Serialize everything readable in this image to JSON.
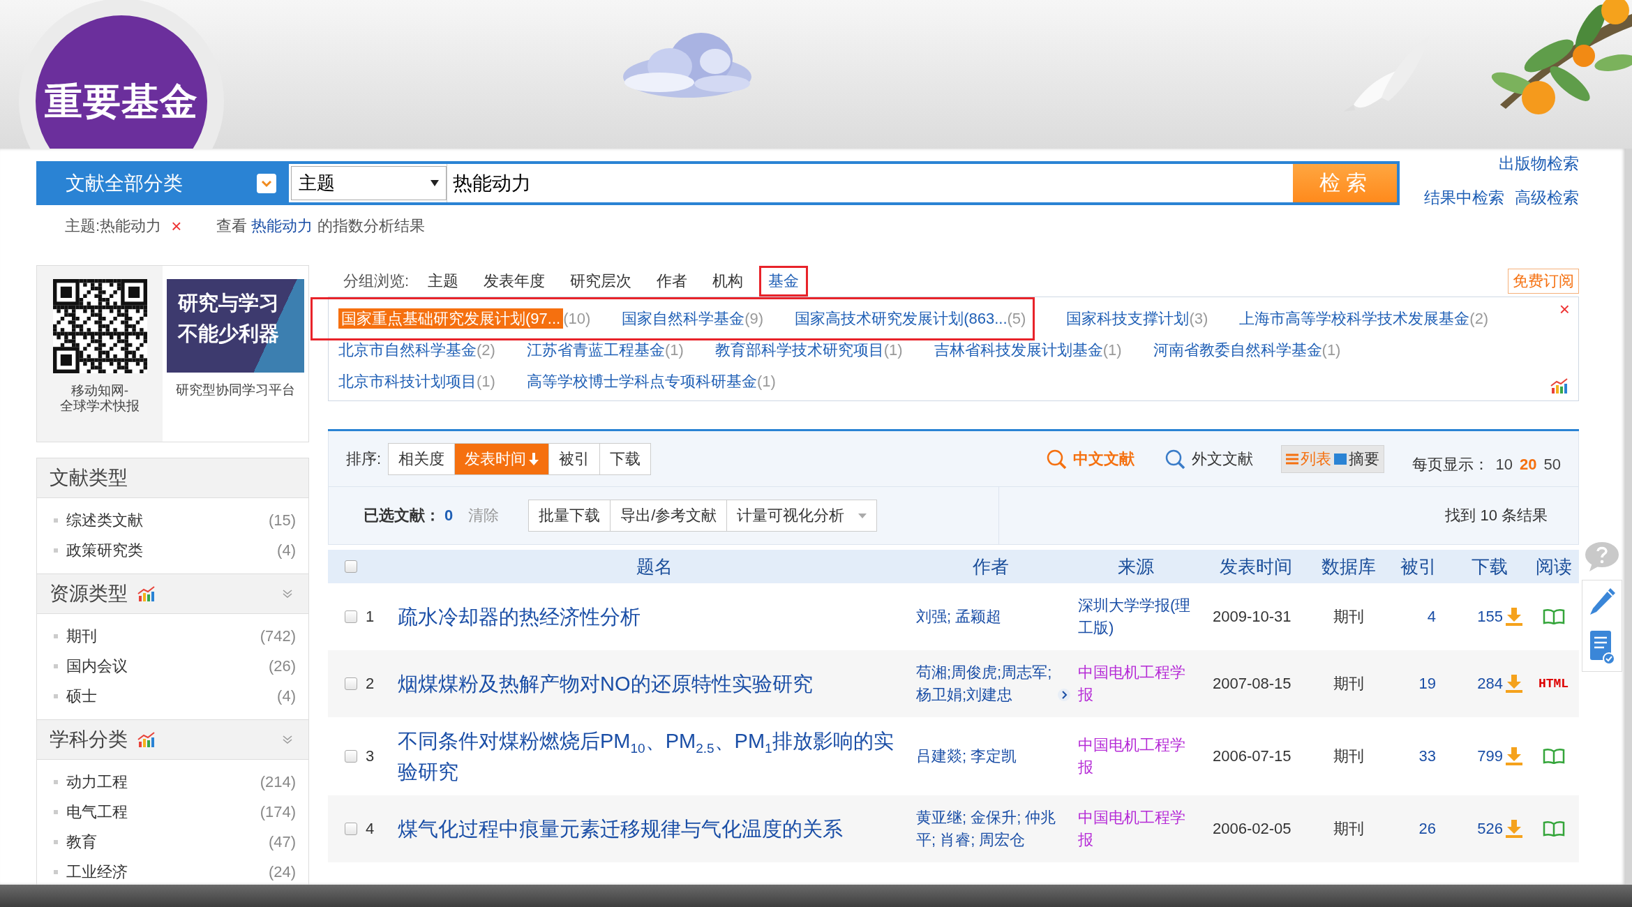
{
  "slide_title": "重要基金",
  "search": {
    "category": "文献全部分类",
    "field": "主题",
    "query": "热能动力",
    "button": "检索",
    "links": [
      "出版物检索",
      "结果中检索",
      "高级检索"
    ]
  },
  "breadcrumb": {
    "filter": "主题:热能动力",
    "remove": "×",
    "index_prefix": "查看 ",
    "index_term": "热能动力",
    "index_suffix": " 的指数分析结果"
  },
  "promo": {
    "qr_caption": [
      "移动知网-",
      "全球学术快报"
    ],
    "banner": [
      "研究与学习",
      "不能少利器"
    ],
    "banner_caption": "研究型协同学习平台"
  },
  "sidebar": {
    "sections": [
      {
        "title": "文献类型",
        "trend_icon": false,
        "collapsible": false,
        "items": [
          {
            "name": "综述类文献",
            "count": "(15)"
          },
          {
            "name": "政策研究类",
            "count": "(4)"
          }
        ]
      },
      {
        "title": "资源类型",
        "trend_icon": true,
        "collapsible": true,
        "items": [
          {
            "name": "期刊",
            "count": "(742)"
          },
          {
            "name": "国内会议",
            "count": "(26)"
          },
          {
            "name": "硕士",
            "count": "(4)"
          }
        ]
      },
      {
        "title": "学科分类",
        "trend_icon": true,
        "collapsible": true,
        "items": [
          {
            "name": "动力工程",
            "count": "(214)"
          },
          {
            "name": "电气工程",
            "count": "(174)"
          },
          {
            "name": "教育",
            "count": "(47)"
          },
          {
            "name": "工业经济",
            "count": "(24)"
          }
        ]
      }
    ]
  },
  "group_browse": {
    "label": "分组浏览:",
    "tabs": [
      {
        "label": "主题",
        "selected": false,
        "highlighted": false
      },
      {
        "label": "发表年度",
        "selected": false,
        "highlighted": false
      },
      {
        "label": "研究层次",
        "selected": false,
        "highlighted": false
      },
      {
        "label": "作者",
        "selected": false,
        "highlighted": false
      },
      {
        "label": "机构",
        "selected": false,
        "highlighted": false
      },
      {
        "label": "基金",
        "selected": true,
        "highlighted": true
      }
    ],
    "subscribe": "免费订阅",
    "close": "×",
    "fund_rows": [
      {
        "items": [
          {
            "name": "国家重点基础研究发展计划(97...",
            "count": "(10)",
            "selected": true,
            "highlighted": true
          },
          {
            "name": "国家自然科学基金",
            "count": "(9)",
            "selected": false,
            "highlighted": true
          },
          {
            "name": "国家高技术研究发展计划(863...",
            "count": "(5)",
            "selected": false,
            "highlighted": true
          },
          {
            "name": "国家科技支撑计划",
            "count": "(3)",
            "selected": false,
            "highlighted": false
          },
          {
            "name": "上海市高等学校科学技术发展基金",
            "count": "(2)",
            "selected": false,
            "highlighted": false
          }
        ]
      },
      {
        "items": [
          {
            "name": "北京市自然科学基金",
            "count": "(2)",
            "selected": false,
            "highlighted": false
          },
          {
            "name": "江苏省青蓝工程基金",
            "count": "(1)",
            "selected": false,
            "highlighted": false
          },
          {
            "name": "教育部科学技术研究项目",
            "count": "(1)",
            "selected": false,
            "highlighted": false
          },
          {
            "name": "吉林省科技发展计划基金",
            "count": "(1)",
            "selected": false,
            "highlighted": false
          },
          {
            "name": "河南省教委自然科学基金",
            "count": "(1)",
            "selected": false,
            "highlighted": false
          }
        ]
      },
      {
        "items": [
          {
            "name": "北京市科技计划项目",
            "count": "(1)",
            "selected": false,
            "highlighted": false
          },
          {
            "name": "高等学校博士学科点专项科研基金",
            "count": "(1)",
            "selected": false,
            "highlighted": false
          }
        ]
      }
    ]
  },
  "results": {
    "sort_label": "排序:",
    "sort_options": [
      {
        "label": "相关度",
        "selected": false
      },
      {
        "label": "发表时间",
        "selected": true
      },
      {
        "label": "被引",
        "selected": false
      },
      {
        "label": "下载",
        "selected": false
      }
    ],
    "languages": [
      {
        "label": "中文文献",
        "selected": true
      },
      {
        "label": "外文文献",
        "selected": false
      }
    ],
    "views": [
      {
        "label": "列表",
        "kind": "list",
        "selected": true
      },
      {
        "label": "摘要",
        "kind": "abstract",
        "selected": false
      }
    ],
    "per_page": {
      "label": "每页显示：",
      "options": [
        {
          "label": "10",
          "selected": false
        },
        {
          "label": "20",
          "selected": true
        },
        {
          "label": "50",
          "selected": false
        }
      ]
    },
    "selection": {
      "label": "已选文献：",
      "count": "0",
      "clear": "清除",
      "actions": [
        "批量下载",
        "导出/参考文献",
        "计量可视化分析"
      ],
      "found": "找到 10 条结果"
    },
    "select_all": {
      "checked": false
    },
    "columns": [
      "题名",
      "作者",
      "来源",
      "发表时间",
      "数据库",
      "被引",
      "下载",
      "阅读"
    ],
    "rows": [
      {
        "number": "1",
        "checked": false,
        "title": "疏水冷却器的热经济性分析",
        "authors": "刘强; 孟颖超",
        "more_authors": false,
        "source": {
          "text": "深圳大学学报(理工版)",
          "color": "#1a4ea6"
        },
        "date": "2009-10-31",
        "database": "期刊",
        "cited": "4",
        "downloads": "155",
        "read": {
          "kind": "book"
        }
      },
      {
        "number": "2",
        "checked": false,
        "title": "烟煤煤粉及热解产物对NO的还原特性实验研究",
        "authors": "苟湘;周俊虎;周志军;杨卫娟;刘建忠",
        "more_authors": true,
        "source": {
          "text": "中国电机工程学报",
          "color": "#b52ad6"
        },
        "date": "2007-08-15",
        "database": "期刊",
        "cited": "19",
        "downloads": "284",
        "read": {
          "kind": "link",
          "label": "HTML"
        }
      },
      {
        "number": "3",
        "checked": false,
        "title": "不同条件对煤粉燃烧后PM$_{10}$、PM$_{2.5}$、PM$_{1}$排放影响的实验研究",
        "authors": "吕建燚; 李定凯",
        "more_authors": false,
        "source": {
          "text": "中国电机工程学报",
          "color": "#b52ad6"
        },
        "date": "2006-07-15",
        "database": "期刊",
        "cited": "33",
        "downloads": "799",
        "read": {
          "kind": "book"
        }
      },
      {
        "number": "4",
        "checked": false,
        "title": "煤气化过程中痕量元素迁移规律与气化温度的关系",
        "authors": "黄亚继; 金保升; 仲兆平; 肖睿; 周宏仓",
        "more_authors": false,
        "source": {
          "text": "中国电机工程学报",
          "color": "#b52ad6"
        },
        "date": "2006-02-05",
        "database": "期刊",
        "cited": "26",
        "downloads": "526",
        "read": {
          "kind": "book"
        }
      }
    ]
  }
}
